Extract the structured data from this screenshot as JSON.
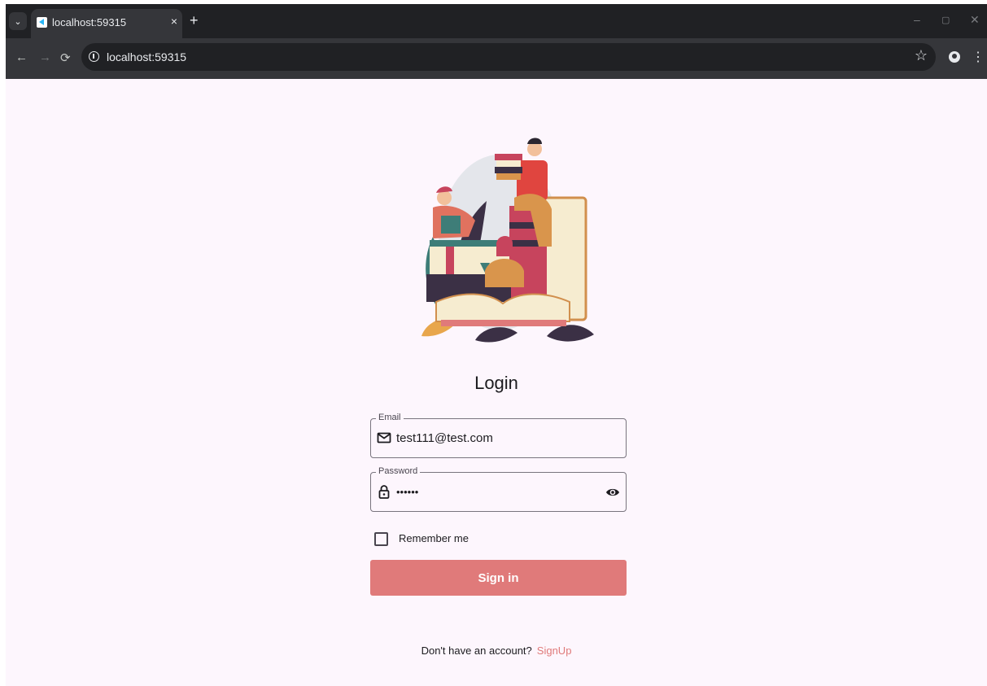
{
  "browser": {
    "tab_title": "localhost:59315",
    "tab_close": "×",
    "new_tab": "+",
    "url": "localhost:59315",
    "minimize": "–",
    "restore": "▢",
    "close": "✕",
    "back": "←",
    "forward": "→",
    "reload": "⟳",
    "star": "☆",
    "menu": "⋮",
    "tab_search": "⌄"
  },
  "login": {
    "title": "Login",
    "email_label": "Email",
    "email_value": "test111@test.com",
    "password_label": "Password",
    "password_value": "••••••",
    "remember_label": "Remember me",
    "remember_checked": false,
    "signin_label": "Sign in",
    "no_account_text": "Don't have an account?",
    "signup_link": "SignUp"
  },
  "colors": {
    "accent": "#e07a7a",
    "page_background": "#fdf6fd",
    "outline": "#79747e"
  },
  "icons": {
    "email": "mail-icon",
    "password": "lock-icon",
    "visibility": "eye-icon"
  }
}
